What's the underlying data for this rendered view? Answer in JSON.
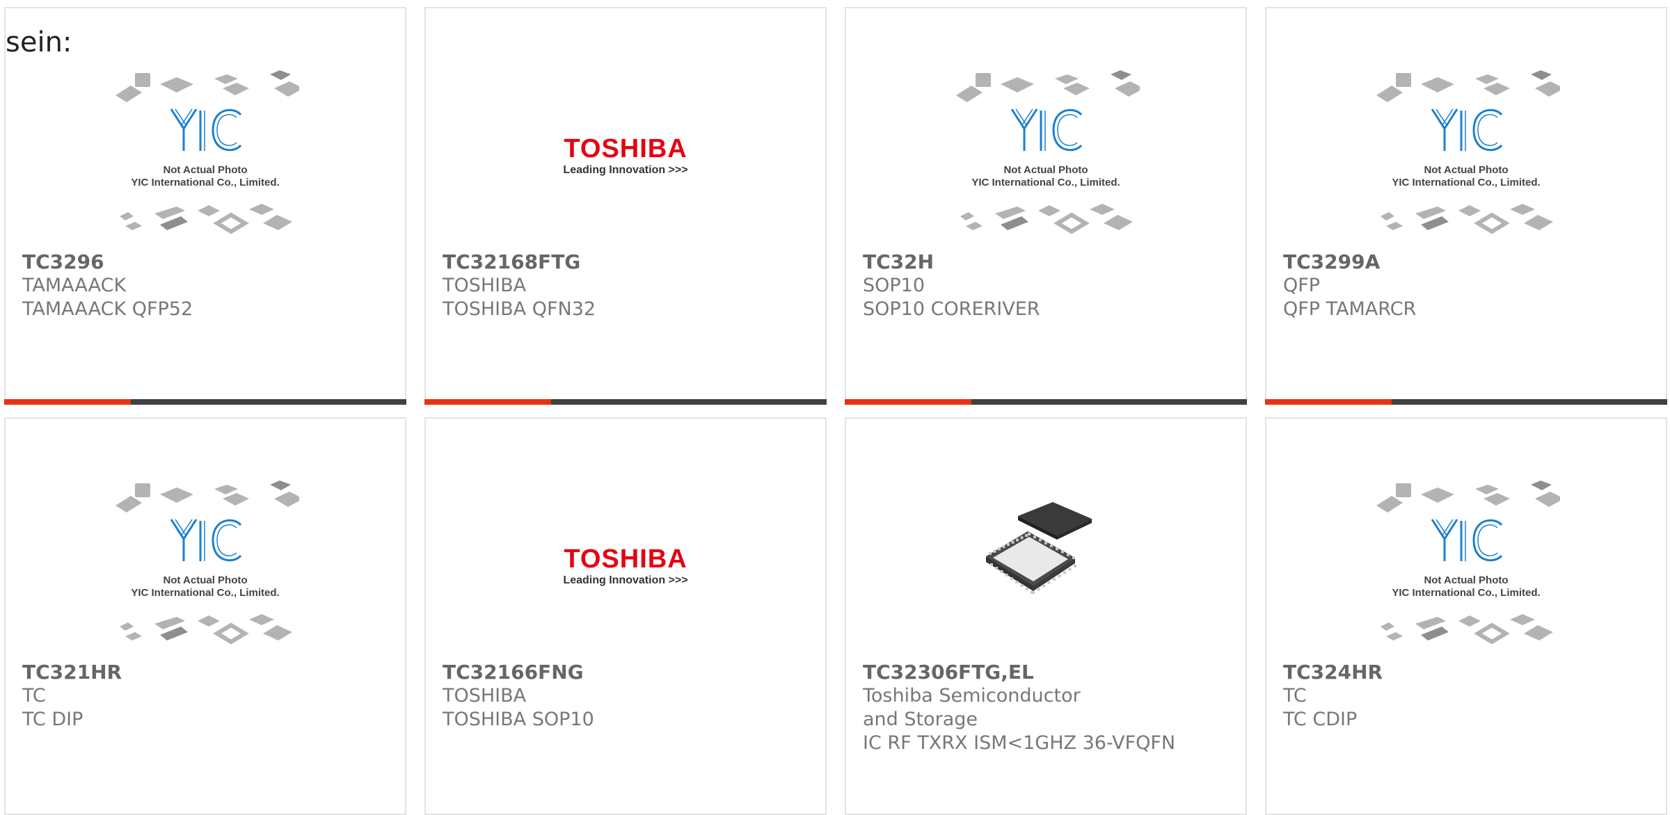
{
  "intro_text": "sein:",
  "placeholder": {
    "line1": "Not Actual Photo",
    "line2": "YIC International Co., Limited."
  },
  "toshiba_logo": {
    "brand": "TOSHIBA",
    "tagline": "Leading Innovation >>>"
  },
  "colors": {
    "accent": "#e63312",
    "bar_dark": "#404040",
    "toshiba_red": "#e60012",
    "yic_blue": "#1a7fd0"
  },
  "cards": [
    {
      "part": "TC3296",
      "mfr": "TAMAAACK",
      "desc": "TAMAAACK QFP52",
      "image": "yic-placeholder"
    },
    {
      "part": "TC32168FTG",
      "mfr": "TOSHIBA",
      "desc": "TOSHIBA QFN32",
      "image": "toshiba-logo"
    },
    {
      "part": "TC32H",
      "mfr": "SOP10",
      "desc": "SOP10 CORERIVER",
      "image": "yic-placeholder"
    },
    {
      "part": "TC3299A",
      "mfr": "QFP",
      "desc": "QFP TAMARCR",
      "image": "yic-placeholder"
    },
    {
      "part": "TC321HR",
      "mfr": "TC",
      "desc": "TC DIP",
      "image": "yic-placeholder"
    },
    {
      "part": "TC32166FNG",
      "mfr": "TOSHIBA",
      "desc": "TOSHIBA SOP10",
      "image": "toshiba-logo"
    },
    {
      "part": "TC32306FTG,EL",
      "mfr": "Toshiba Semiconductor and Storage",
      "desc": "IC RF TXRX ISM<1GHZ 36-VFQFN",
      "image": "qfn-chip-photo"
    },
    {
      "part": "TC324HR",
      "mfr": "TC",
      "desc": "TC CDIP",
      "image": "yic-placeholder"
    }
  ]
}
